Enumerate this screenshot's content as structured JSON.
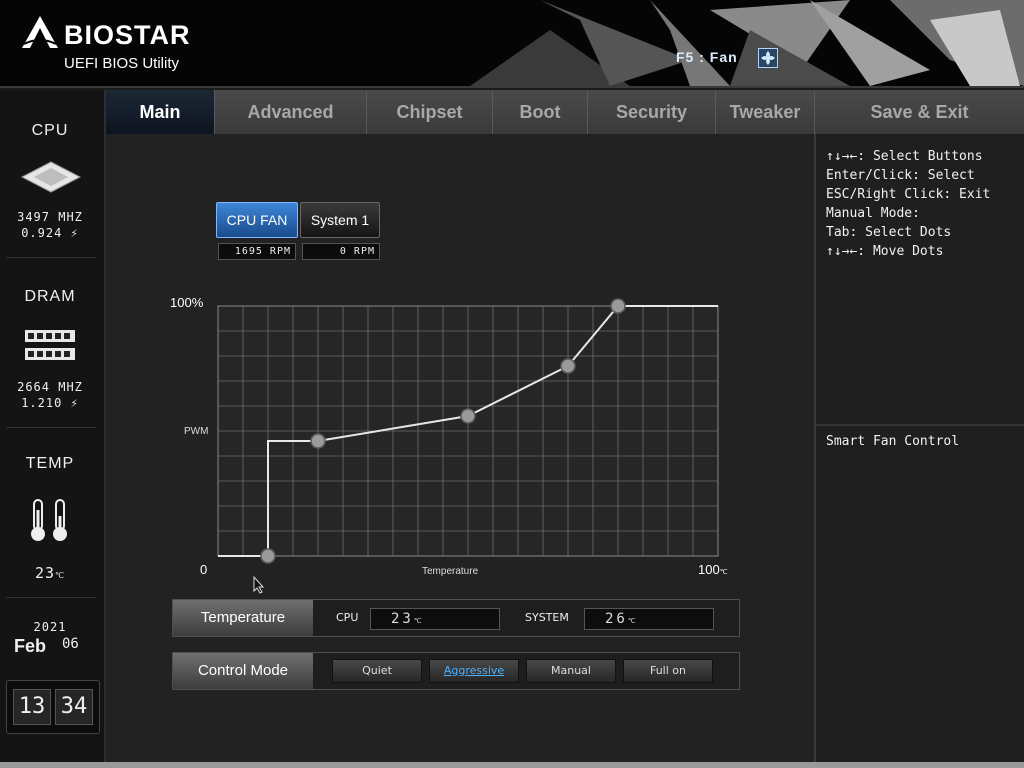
{
  "brand": {
    "name": "BIOSTAR",
    "subtitle": "UEFI BIOS Utility"
  },
  "header": {
    "fan_hint": "F5 : Fan"
  },
  "sidebar": {
    "cpu": {
      "title": "CPU",
      "freq": "3497 MHZ",
      "volt": "0.924"
    },
    "dram": {
      "title": "DRAM",
      "freq": "2664 MHZ",
      "volt": "1.210"
    },
    "temp": {
      "title": "TEMP",
      "value": "23"
    },
    "date": {
      "year": "2021",
      "month": "Feb",
      "day": "06"
    },
    "time": {
      "hour": "13",
      "minute": "34"
    }
  },
  "tabs": [
    "Main",
    "Advanced",
    "Chipset",
    "Boot",
    "Security",
    "Tweaker",
    "Save & Exit"
  ],
  "fan_tabs": [
    {
      "label": "CPU FAN",
      "rpm": "1695 RPM",
      "active": true
    },
    {
      "label": "System 1",
      "rpm": "0 RPM",
      "active": false
    }
  ],
  "chart_data": {
    "type": "line",
    "xlabel": "Temperature",
    "ylabel": "PWM",
    "x_min_label": "0",
    "x_max_label": "100",
    "x_unit": "℃",
    "y_max_label": "100%",
    "xlim": [
      0,
      100
    ],
    "ylim": [
      0,
      100
    ],
    "grid": true,
    "series": [
      {
        "x": [
          10,
          20,
          50,
          70,
          80
        ],
        "y": [
          0,
          46,
          56,
          76,
          100
        ]
      }
    ]
  },
  "temperature": {
    "label": "Temperature",
    "cpu_label": "CPU",
    "cpu_value": "23",
    "system_label": "SYSTEM",
    "system_value": "26"
  },
  "control_mode": {
    "label": "Control Mode",
    "options": [
      "Quiet",
      "Aggressive",
      "Manual",
      "Full on"
    ],
    "selected": "Aggressive"
  },
  "help": {
    "lines": [
      "↑↓→←: Select Buttons",
      "Enter/Click: Select",
      "ESC/Right Click: Exit",
      "Manual Mode:",
      "Tab: Select Dots",
      "↑↓→←: Move Dots"
    ],
    "description": "Smart Fan Control"
  },
  "colors": {
    "accent": "#2a6fc0",
    "selected_text": "#4cb2ff"
  }
}
